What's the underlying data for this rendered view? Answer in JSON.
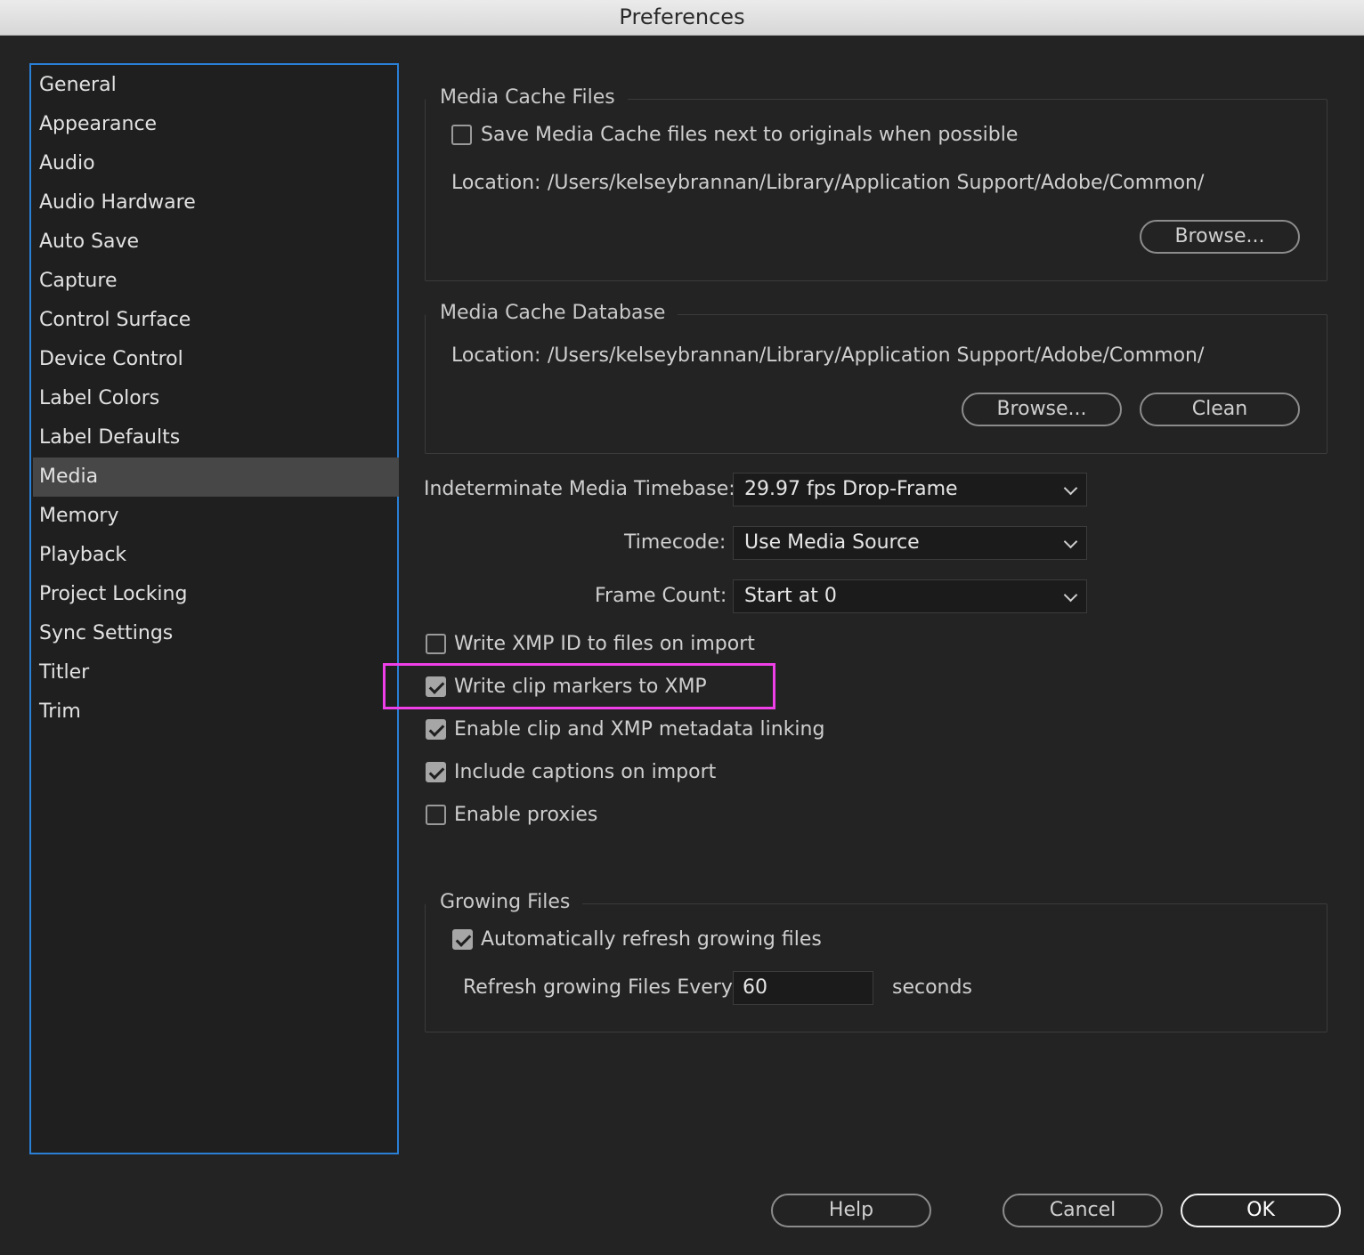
{
  "window": {
    "title": "Preferences"
  },
  "sidebar": {
    "items": [
      {
        "label": "General"
      },
      {
        "label": "Appearance"
      },
      {
        "label": "Audio"
      },
      {
        "label": "Audio Hardware"
      },
      {
        "label": "Auto Save"
      },
      {
        "label": "Capture"
      },
      {
        "label": "Control Surface"
      },
      {
        "label": "Device Control"
      },
      {
        "label": "Label Colors"
      },
      {
        "label": "Label Defaults"
      },
      {
        "label": "Media"
      },
      {
        "label": "Memory"
      },
      {
        "label": "Playback"
      },
      {
        "label": "Project Locking"
      },
      {
        "label": "Sync Settings"
      },
      {
        "label": "Titler"
      },
      {
        "label": "Trim"
      }
    ],
    "selected": "Media"
  },
  "media_cache_files": {
    "title": "Media Cache Files",
    "save_next_to_originals": {
      "label": "Save Media Cache files next to originals when possible",
      "checked": false
    },
    "location_label": "Location:",
    "location_path": "/Users/kelseybrannan/Library/Application Support/Adobe/Common/",
    "browse_label": "Browse..."
  },
  "media_cache_database": {
    "title": "Media Cache Database",
    "location_label": "Location:",
    "location_path": "/Users/kelseybrannan/Library/Application Support/Adobe/Common/",
    "browse_label": "Browse...",
    "clean_label": "Clean"
  },
  "settings": {
    "timebase": {
      "label": "Indeterminate Media Timebase:",
      "value": "29.97 fps Drop-Frame"
    },
    "timecode": {
      "label": "Timecode:",
      "value": "Use Media Source"
    },
    "frame_count": {
      "label": "Frame Count:",
      "value": "Start at 0"
    }
  },
  "options": [
    {
      "label": "Write XMP ID to files on import",
      "checked": false
    },
    {
      "label": "Write clip markers to XMP",
      "checked": true
    },
    {
      "label": "Enable clip and XMP metadata linking",
      "checked": true
    },
    {
      "label": "Include captions on import",
      "checked": true
    },
    {
      "label": "Enable proxies",
      "checked": false
    }
  ],
  "growing_files": {
    "title": "Growing Files",
    "auto_refresh": {
      "label": "Automatically refresh growing files",
      "checked": true
    },
    "refresh_label": "Refresh growing Files Every",
    "refresh_value": "60",
    "seconds_label": "seconds"
  },
  "footer": {
    "help_label": "Help",
    "cancel_label": "Cancel",
    "ok_label": "OK"
  },
  "colors": {
    "highlight": "#ee3fe8",
    "sidebar_border": "#2a7fd6",
    "selected_item": "#474747"
  }
}
